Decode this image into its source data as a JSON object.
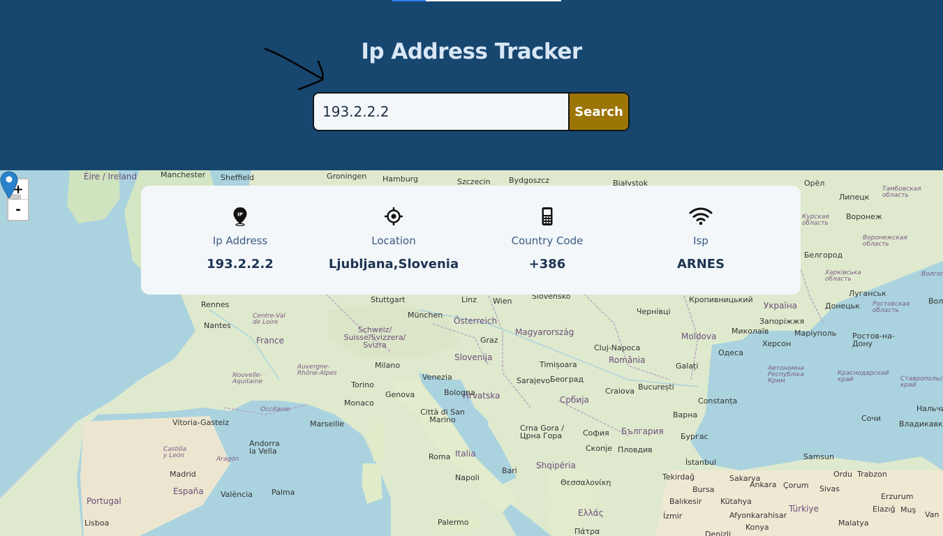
{
  "header": {
    "title": "Ip Address Tracker",
    "search": {
      "value": "193.2.2.2",
      "button_label": "Search"
    }
  },
  "map": {
    "zoom_in_label": "+",
    "zoom_out_label": "-",
    "labels": [
      "Éire / Ireland",
      "Manchester",
      "Sheffield",
      "Groningen",
      "Hamburg",
      "Szczecin",
      "Bydgoszcz",
      "Białystok",
      "Орёл",
      "Липецк",
      "Воронеж",
      "Белгород",
      "Курская область",
      "Тамбовская область",
      "Воронежская область",
      "Харківська область",
      "Луганськ",
      "Stuttgart",
      "München",
      "Linz",
      "Wien",
      "Slovensko",
      "Rennes",
      "Nantes",
      "Centre-Val de Loire",
      "France",
      "Schweiz/ Suisse/Svizzera/ Svizra",
      "Österreich",
      "Graz",
      "Slovenija",
      "Magyarország",
      "Cluj-Napoca",
      "România",
      "Moldova",
      "Кропивницький",
      "Чернівці",
      "Україна",
      "Донецьк",
      "Запоріжжя",
      "Миколаїв",
      "Маріуполь",
      "Херсон",
      "Ростов-на-Дону",
      "Ростовская область",
      "Одеса",
      "Milano",
      "Auvergne-Rhône-Alpes",
      "Nouvelle-Aquitaine",
      "Occitanie",
      "Torino",
      "Genova",
      "Venezia",
      "Bologna",
      "Hrvatska",
      "Monaco",
      "Timișoara",
      "Београд",
      "Sarajevo",
      "Србија",
      "Craiova",
      "București",
      "Galați",
      "Constanța",
      "Автономна Республіка Крим",
      "Краснодарский край",
      "Ставропольский край",
      "Vitoria-Gasteiz",
      "Marseille",
      "Città di San Marino",
      "Crna Gora / Црна Гора",
      "София",
      "България",
      "Варна",
      "Бургас",
      "Скопје",
      "Пловдив",
      "Andorra la Vella",
      "Castilla y León",
      "Aragón",
      "Roma",
      "Italia",
      "Shqipëria",
      "İstanbul",
      "Samsun",
      "Madrid",
      "España",
      "Napoli",
      "Bari",
      "Θεσσαλονίκη",
      "Tekirdağ",
      "Sakarya",
      "Ankara",
      "Çorum",
      "Sivas",
      "Ordu",
      "Trabzon",
      "Portugal",
      "València",
      "Palma",
      "Bursa",
      "Balıkesir",
      "Kütahya",
      "Erzurum",
      "Lisboa",
      "Palermo",
      "Ελλάς",
      "İzmir",
      "Afyonkarahisar",
      "Türkiye",
      "Malatya",
      "Elazığ",
      "Muş",
      "Van",
      "Konya",
      "Denizli",
      "Πάτρα",
      "Сочи",
      "Владикавказ",
      "Нальчик",
      "Волгоградская",
      "Вол"
    ]
  },
  "info": {
    "items": [
      {
        "label": "Ip Address",
        "value": "193.2.2.2",
        "icon": "ip-pin-icon"
      },
      {
        "label": "Location",
        "value": "Ljubljana,Slovenia",
        "icon": "crosshair-icon"
      },
      {
        "label": "Country Code",
        "value": "+386",
        "icon": "phone-icon"
      },
      {
        "label": "Isp",
        "value": "ARNES",
        "icon": "wifi-icon"
      }
    ]
  },
  "colors": {
    "header_bg": "#17466e",
    "title": "#d8e7f6",
    "button": "#9b7506",
    "card_bg": "#f3f7fa",
    "value_text": "#1d3451",
    "label_text": "#3a5a80"
  }
}
